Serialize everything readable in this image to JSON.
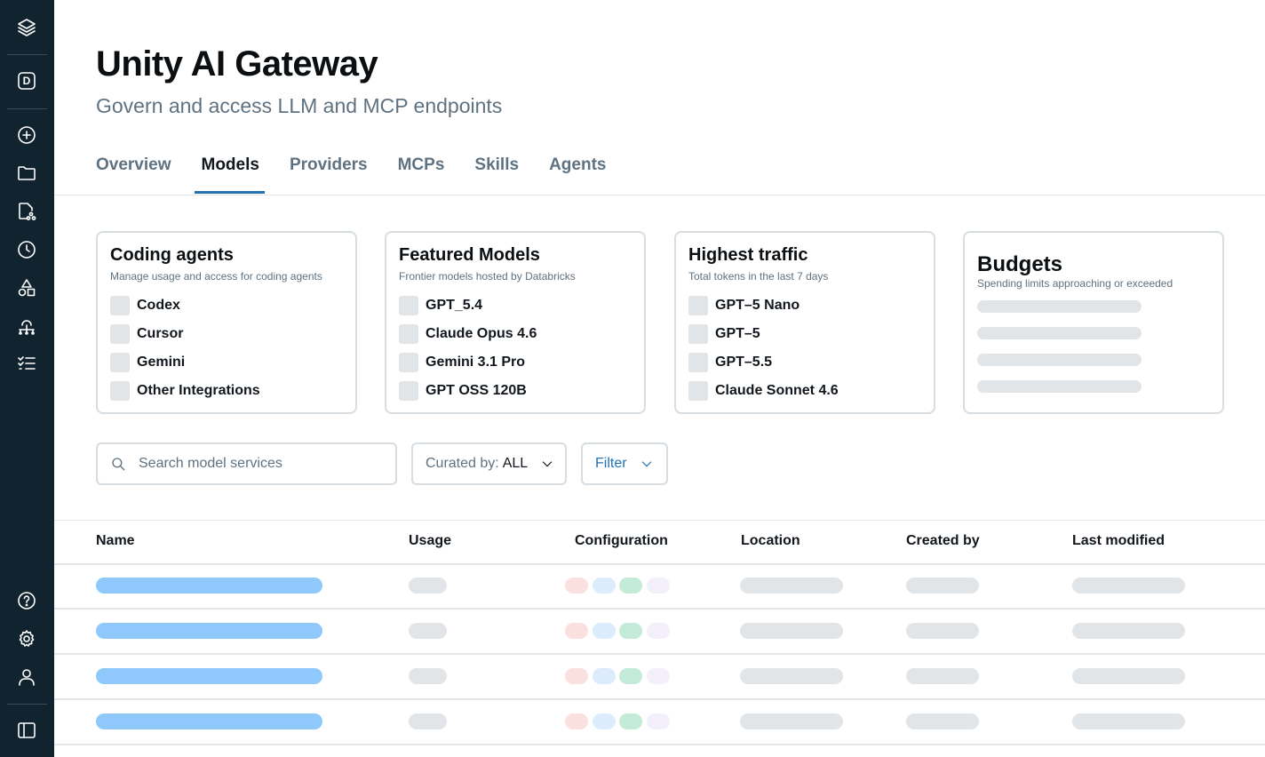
{
  "header": {
    "title": "Unity AI Gateway",
    "subtitle": "Govern and access LLM and MCP endpoints"
  },
  "sidebar": {
    "workspace_letter": "D",
    "icons": [
      "layers-logo-icon",
      "workspace-icon",
      "add-icon",
      "folder-icon",
      "file-share-icon",
      "history-icon",
      "shapes-icon",
      "hierarchy-icon",
      "checklist-icon",
      "help-icon",
      "settings-icon",
      "user-icon",
      "panel-toggle-icon"
    ]
  },
  "tabs": [
    {
      "label": "Overview",
      "active": false
    },
    {
      "label": "Models",
      "active": true
    },
    {
      "label": "Providers",
      "active": false
    },
    {
      "label": "MCPs",
      "active": false
    },
    {
      "label": "Skills",
      "active": false
    },
    {
      "label": "Agents",
      "active": false
    }
  ],
  "cards": {
    "coding": {
      "title": "Coding agents",
      "subtitle": "Manage usage and access for coding agents",
      "items": [
        "Codex",
        "Cursor",
        "Gemini",
        "Other Integrations"
      ]
    },
    "featured": {
      "title": "Featured Models",
      "subtitle": "Frontier models hosted by Databricks",
      "items": [
        "GPT_5.4",
        "Claude Opus 4.6",
        "Gemini 3.1 Pro",
        "GPT OSS 120B"
      ]
    },
    "traffic": {
      "title": "Highest traffic",
      "subtitle": "Total tokens in the last 7 days",
      "items": [
        "GPT–5 Nano",
        "GPT–5",
        "GPT–5.5",
        "Claude Sonnet 4.6"
      ]
    },
    "budgets": {
      "title": "Budgets",
      "subtitle": "Spending limits approaching or exceeded"
    }
  },
  "controls": {
    "search_placeholder": "Search model services",
    "curated_label": "Curated by:",
    "curated_value": "ALL",
    "filter_label": "Filter"
  },
  "table": {
    "columns": [
      "Name",
      "Usage",
      "Configuration",
      "Location",
      "Created by",
      "Last modified"
    ]
  },
  "colors": {
    "sidebar_bg": "#11232f",
    "accent": "#2272b4",
    "name_skeleton": "#8fc9fb",
    "config_chips": [
      "#fbe0e0",
      "#dcecfc",
      "#c4ead9",
      "#f3f0fb"
    ],
    "skeleton": "#e2e5e8"
  }
}
